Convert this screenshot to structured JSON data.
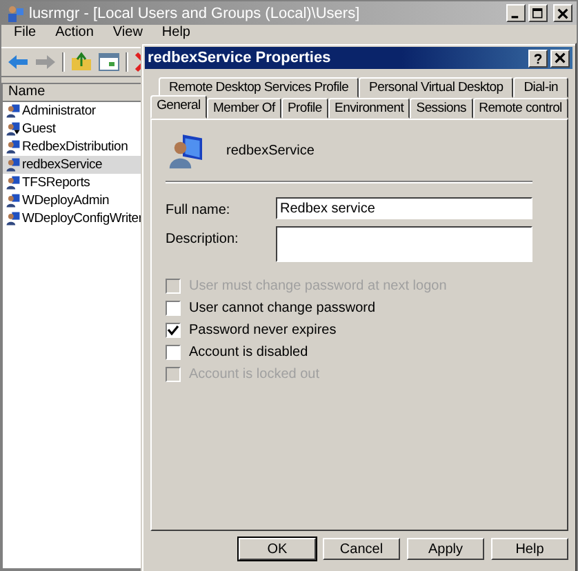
{
  "main_window": {
    "title": "lusrmgr - [Local Users and Groups (Local)\\Users]",
    "menu": [
      "File",
      "Action",
      "View",
      "Help"
    ],
    "list": {
      "column": "Name",
      "items": [
        {
          "name": "Administrator",
          "selected": false,
          "disabled": false
        },
        {
          "name": "Guest",
          "selected": false,
          "disabled": true
        },
        {
          "name": "RedbexDistribution",
          "selected": false,
          "disabled": false
        },
        {
          "name": "redbexService",
          "selected": true,
          "disabled": false
        },
        {
          "name": "TFSReports",
          "selected": false,
          "disabled": false
        },
        {
          "name": "WDeployAdmin",
          "selected": false,
          "disabled": false
        },
        {
          "name": "WDeployConfigWriter",
          "selected": false,
          "disabled": false
        }
      ]
    }
  },
  "dialog": {
    "title": "redbexService Properties",
    "tab_rows": [
      [
        {
          "label": "Remote Desktop Services Profile",
          "selected": false
        },
        {
          "label": "Personal Virtual Desktop",
          "selected": false
        },
        {
          "label": "Dial-in",
          "selected": false
        }
      ],
      [
        {
          "label": "General",
          "selected": true
        },
        {
          "label": "Member Of",
          "selected": false
        },
        {
          "label": "Profile",
          "selected": false
        },
        {
          "label": "Environment",
          "selected": false
        },
        {
          "label": "Sessions",
          "selected": false
        },
        {
          "label": "Remote control",
          "selected": false
        }
      ]
    ],
    "user_name": "redbexService",
    "fields": [
      {
        "label": "Full name:",
        "value": "Redbex service",
        "kind": "line"
      },
      {
        "label": "Description:",
        "kind": "area"
      }
    ],
    "checkboxes": [
      {
        "label": "User must change password at next logon",
        "checked": false,
        "disabled": true
      },
      {
        "label": "User cannot change password",
        "checked": false,
        "disabled": false
      },
      {
        "label": "Password never expires",
        "checked": true,
        "disabled": false
      },
      {
        "label": "Account is disabled",
        "checked": false,
        "disabled": false
      },
      {
        "label": "Account is locked out",
        "checked": false,
        "disabled": true
      }
    ],
    "buttons": [
      {
        "label": "OK",
        "default": true
      },
      {
        "label": "Cancel",
        "default": false
      },
      {
        "label": "Apply",
        "default": false
      },
      {
        "label": "Help",
        "default": false
      }
    ]
  }
}
